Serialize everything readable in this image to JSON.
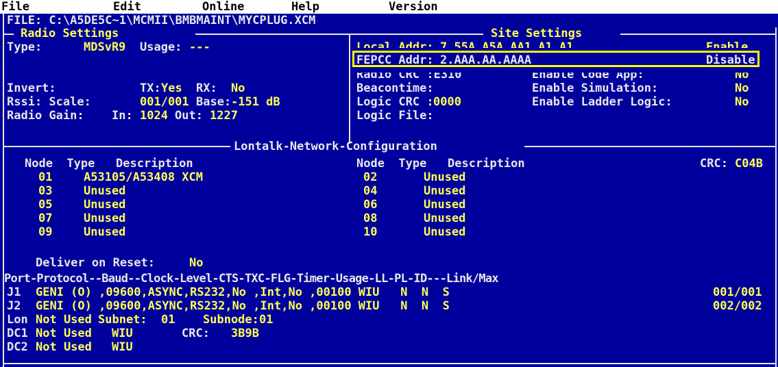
{
  "menu": {
    "file": "File",
    "edit": "Edit",
    "online": "Online",
    "help": "Help",
    "version": "Version"
  },
  "file_path": "FILE: C:\\A5DE5C~1\\MCMII\\BMBMAINT\\MYCPLUG.XCM",
  "radio_settings": {
    "title": "Radio Settings",
    "type_label": "Type:",
    "type_value": "MDSvR9",
    "usage_label": "Usage:",
    "usage_value": "---",
    "invert_label": "Invert:",
    "tx_label": "TX:",
    "tx_value": "Yes",
    "rx_label": "RX:",
    "rx_value": "No",
    "rssi_label": "Rssi: Scale:",
    "scale_value": "001/001",
    "base_label": "Base:",
    "base_value": "-151 dB",
    "gain_label": "Radio Gain:",
    "in_label": "In:",
    "in_value": "1024",
    "out_label": "Out:",
    "out_value": "1227"
  },
  "site_settings": {
    "title": "Site Settings",
    "local_addr_label": "Local Addr:",
    "local_addr_value": "7.55A.A5A.AA1.A1.A1",
    "local_addr_status": "Enable",
    "fepcc_addr_label": "FEPCC Addr:",
    "fepcc_addr_value": "2.AAA.AA.AAAA",
    "fepcc_addr_status": "Disable",
    "radio_crc": "Radio CRC :E310",
    "enable_code_app": "Enable Code App:",
    "enable_code_app_value": "No",
    "beacontime": "Beacontime:",
    "enable_simulation": "Enable Simulation:",
    "enable_simulation_value": "No",
    "logic_crc_label": "Logic CRC :",
    "logic_crc_value": "0000",
    "enable_ladder_logic": "Enable Ladder Logic:",
    "enable_ladder_logic_value": "No",
    "logic_file": "Logic File:"
  },
  "lontalk": {
    "title": "Lontalk-Network-Configuration",
    "header_left": "Node  Type   Description",
    "header_right": "Node  Type   Description",
    "crc_label": "CRC:",
    "crc_value": "C04B",
    "left_nodes": [
      {
        "node": "01",
        "desc": "A53105/A53408 XCM"
      },
      {
        "node": "03",
        "desc": "Unused"
      },
      {
        "node": "05",
        "desc": "Unused"
      },
      {
        "node": "07",
        "desc": "Unused"
      },
      {
        "node": "09",
        "desc": "Unused"
      }
    ],
    "right_nodes": [
      {
        "node": "02",
        "desc": "Unused"
      },
      {
        "node": "04",
        "desc": "Unused"
      },
      {
        "node": "06",
        "desc": "Unused"
      },
      {
        "node": "08",
        "desc": "Unused"
      },
      {
        "node": "10",
        "desc": "Unused"
      }
    ],
    "deliver_label": "Deliver on Reset:",
    "deliver_value": "No"
  },
  "ports": {
    "header": "Port-Protocol--Baud--Clock-Level-CTS-TXC-FLG-Timer-Usage-LL-PL-ID---Link/Max",
    "rows": [
      {
        "port": "J1",
        "data": "GENI (O) ,09600,ASYNC,RS232,No ,Int,No ,00100 WIU   N  N  S",
        "link": "001/001"
      },
      {
        "port": "J2",
        "data": "GENI (O) ,09600,ASYNC,RS232,No ,Int,No ,00100 WIU   N  N  S",
        "link": "002/002"
      }
    ],
    "lon": {
      "port": "Lon",
      "value": "Not Used",
      "subnet_label": "Subnet:",
      "subnet_value": "01",
      "subnode_label": "Subnode:",
      "subnode_value": "01"
    },
    "dc1": {
      "port": "DC1",
      "value": "Not Used",
      "usage": "WIU",
      "crc_label": "CRC:",
      "crc_value": "3B9B"
    },
    "dc2": {
      "port": "DC2",
      "value": "Not Used",
      "usage": "WIU"
    }
  },
  "colors": {
    "background": "#00009c",
    "text": "#e8e8e8",
    "value": "#ffff55",
    "highlight_box": "#ffff00"
  }
}
